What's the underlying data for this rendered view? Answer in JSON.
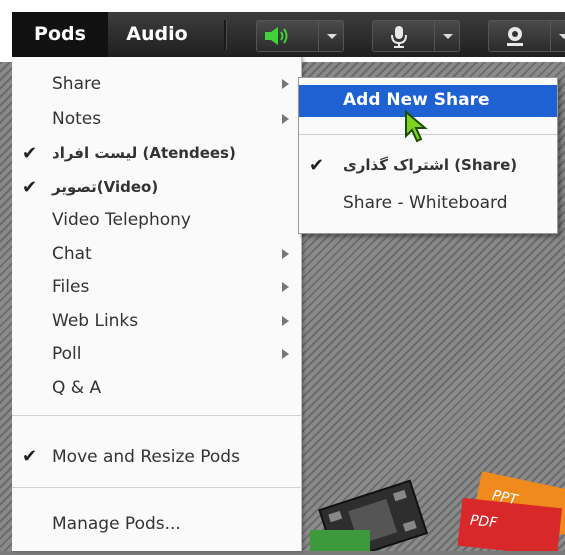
{
  "menubar": {
    "pods_label": "Pods",
    "audio_label": "Audio",
    "speaker_icon": "speaker-icon",
    "mic_icon": "microphone-icon",
    "camera_icon": "webcam-icon",
    "speaker_color": "#3fd43a"
  },
  "pods_menu": {
    "items": [
      {
        "label": "Share",
        "checked": false,
        "submenu": true
      },
      {
        "label": "Notes",
        "checked": false,
        "submenu": true
      },
      {
        "label": "لیست افراد (Atendees)",
        "checked": true,
        "submenu": false
      },
      {
        "label": "تصویر(Video)",
        "checked": true,
        "submenu": false
      },
      {
        "label": "Video Telephony",
        "checked": false,
        "submenu": false
      },
      {
        "label": "Chat",
        "checked": false,
        "submenu": true
      },
      {
        "label": "Files",
        "checked": false,
        "submenu": true
      },
      {
        "label": "Web Links",
        "checked": false,
        "submenu": true
      },
      {
        "label": "Poll",
        "checked": false,
        "submenu": true
      },
      {
        "label": "Q & A",
        "checked": false,
        "submenu": false
      },
      {
        "label": "Move and Resize Pods",
        "checked": true,
        "submenu": false
      },
      {
        "label": "Manage Pods...",
        "checked": false,
        "submenu": false
      }
    ],
    "check_glyph": "✔"
  },
  "share_submenu": {
    "items": [
      {
        "label": "Add New Share",
        "highlighted": true
      },
      {
        "label": "اشتراک گذاری (Share)",
        "checked": true
      },
      {
        "label": "Share - Whiteboard",
        "checked": false
      }
    ]
  },
  "files_graphic": {
    "ppt_label": "PPT",
    "pdf_label": "PDF"
  }
}
